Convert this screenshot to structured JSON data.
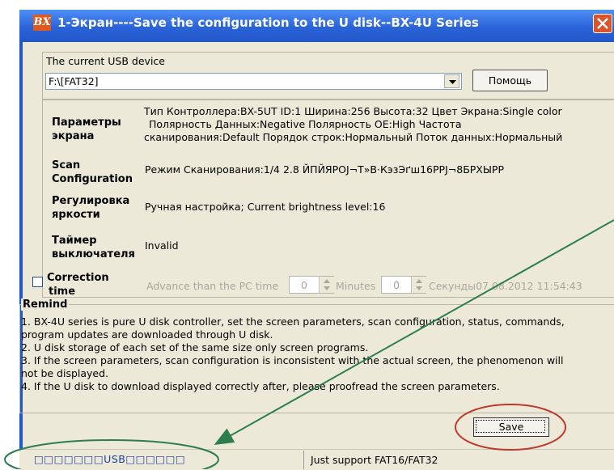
{
  "window": {
    "title": "1-Экран----Save the configuration to the U disk--BX-4U Series",
    "icon_text": "BX"
  },
  "usb": {
    "group_label": "The current USB device",
    "selected": "F:\\[FAT32]",
    "help_label": "Помощь"
  },
  "params": {
    "screen": {
      "label_line1": "Параметры",
      "label_line2": "экрана",
      "value_line1": "Тип Контроллера:BX-5UT  ID:1  Ширина:256  Высота:32  Цвет Экрана:Single color",
      "value_line2": "Полярность Данных:Negative  Полярность OE:High  Частота",
      "value_line3": "сканирования:Default  Порядок строк:Нормальный  Поток данных:Нормальный"
    },
    "scan": {
      "label_line1": "Scan",
      "label_line2": "Configuration",
      "value": "Режим Сканирования:1/4    2.8 ЙПЙЯРОЈ¬Т»В·КэзЭґш16РРЈ¬8БРХЫРР"
    },
    "brightness": {
      "label_line1": "Регулировка",
      "label_line2": "яркости",
      "value": "Ручная настройка;  Current brightness level:16"
    },
    "timer": {
      "label_line1": "Таймер",
      "label_line2": "выключателя",
      "value": "Invalid"
    },
    "correction": {
      "label_line1": "Correction",
      "label_line2": "time",
      "advance_label": "Advance than the PC time",
      "minutes_value": "0",
      "minutes_label": "Minutes",
      "seconds_value": "0",
      "seconds_label": "Секунды",
      "datetime": "07.08.2012 11:54:43"
    }
  },
  "remind": {
    "title": "Remind",
    "lines": [
      "  1.  BX-4U series is pure U disk controller, set the screen parameters, scan configuration, status, commands,",
      "program updates are downloaded through U disk.",
      "  2.  U disk storage of each set of the same size only screen programs.",
      "  3.  If the screen parameters, scan configuration is inconsistent with the actual screen, the phenomenon will",
      "not be displayed.",
      "  4.  If the U disk to download displayed correctly after, please proofread the screen parameters."
    ]
  },
  "save_label": "Save",
  "status": {
    "left": "□□□□□□□USB□□□□□□",
    "right": "Just support FAT16/FAT32"
  },
  "colors": {
    "titlebar": "#2a63d8",
    "window_bg": "#ece9d8",
    "annotation": "#c0392b",
    "arrow": "#2e7d4f"
  }
}
